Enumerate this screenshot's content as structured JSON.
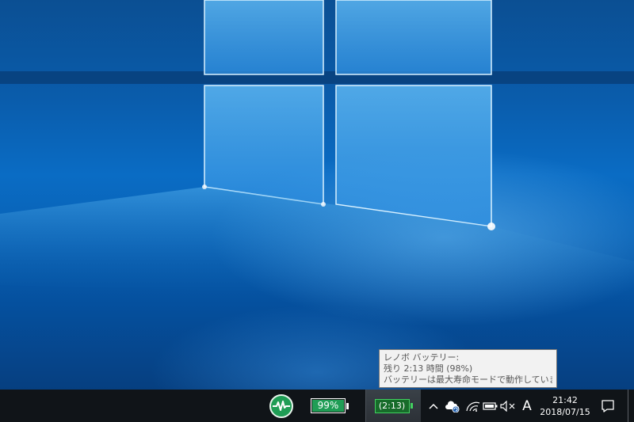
{
  "tooltip": {
    "line1": "レノボ バッテリー:",
    "line2": "残り 2:13 時間 (98%)",
    "line3": "バッテリーは最大寿命モードで動作しています。"
  },
  "taskbar": {
    "battery_meter": {
      "label": "99%",
      "level_percent": 99,
      "fill_color": "#1f9d55"
    },
    "battery_time": {
      "label": "(2:13)",
      "fill_color": "#176b2a"
    },
    "ime_mode": "A",
    "clock": {
      "time": "21:42",
      "date": "2018/07/15"
    }
  },
  "tray_icons": [
    "chevron-up-icon",
    "onedrive-sync-icon",
    "wifi-icon",
    "battery-icon",
    "volume-muted-icon"
  ],
  "colors": {
    "taskbar": "#101418",
    "accent_green": "#1f9d55",
    "wallpaper_blue": "#0a6cc4"
  }
}
